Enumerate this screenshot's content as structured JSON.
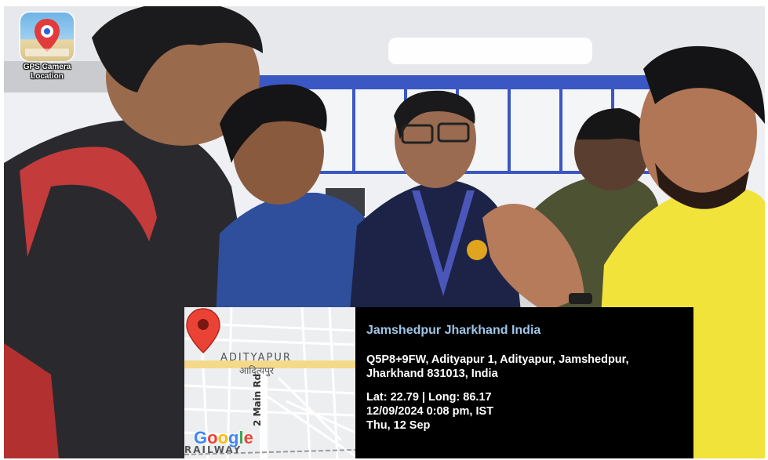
{
  "app_badge": {
    "icon": "gps-camera-app-icon",
    "label_line1": "GPS Camera",
    "label_line2": "Location"
  },
  "map": {
    "area_name": "ADITYAPUR",
    "area_name_local": "आदित्यपुर",
    "road_name": "2 Main Rd",
    "rail_label": "RAILWAY",
    "logo_letters": [
      "G",
      "o",
      "o",
      "g",
      "l",
      "e"
    ],
    "logo_colors": [
      "#4285F4",
      "#EA4335",
      "#FBBC05",
      "#4285F4",
      "#34A853",
      "#EA4335"
    ],
    "pin_color": "#EA4335"
  },
  "location": {
    "title": "Jamshedpur Jharkhand India",
    "address_line1": "Q5P8+9FW, Adityapur 1, Adityapur, Jamshedpur,",
    "address_line2": "Jharkhand 831013, India",
    "coords": "Lat: 22.79 | Long: 86.17",
    "datetime": "12/09/2024  0:08 pm, IST",
    "day": "Thu, 12 Sep"
  },
  "colors": {
    "title_blue": "#9ec6e8",
    "stamp_background": "#000000"
  }
}
